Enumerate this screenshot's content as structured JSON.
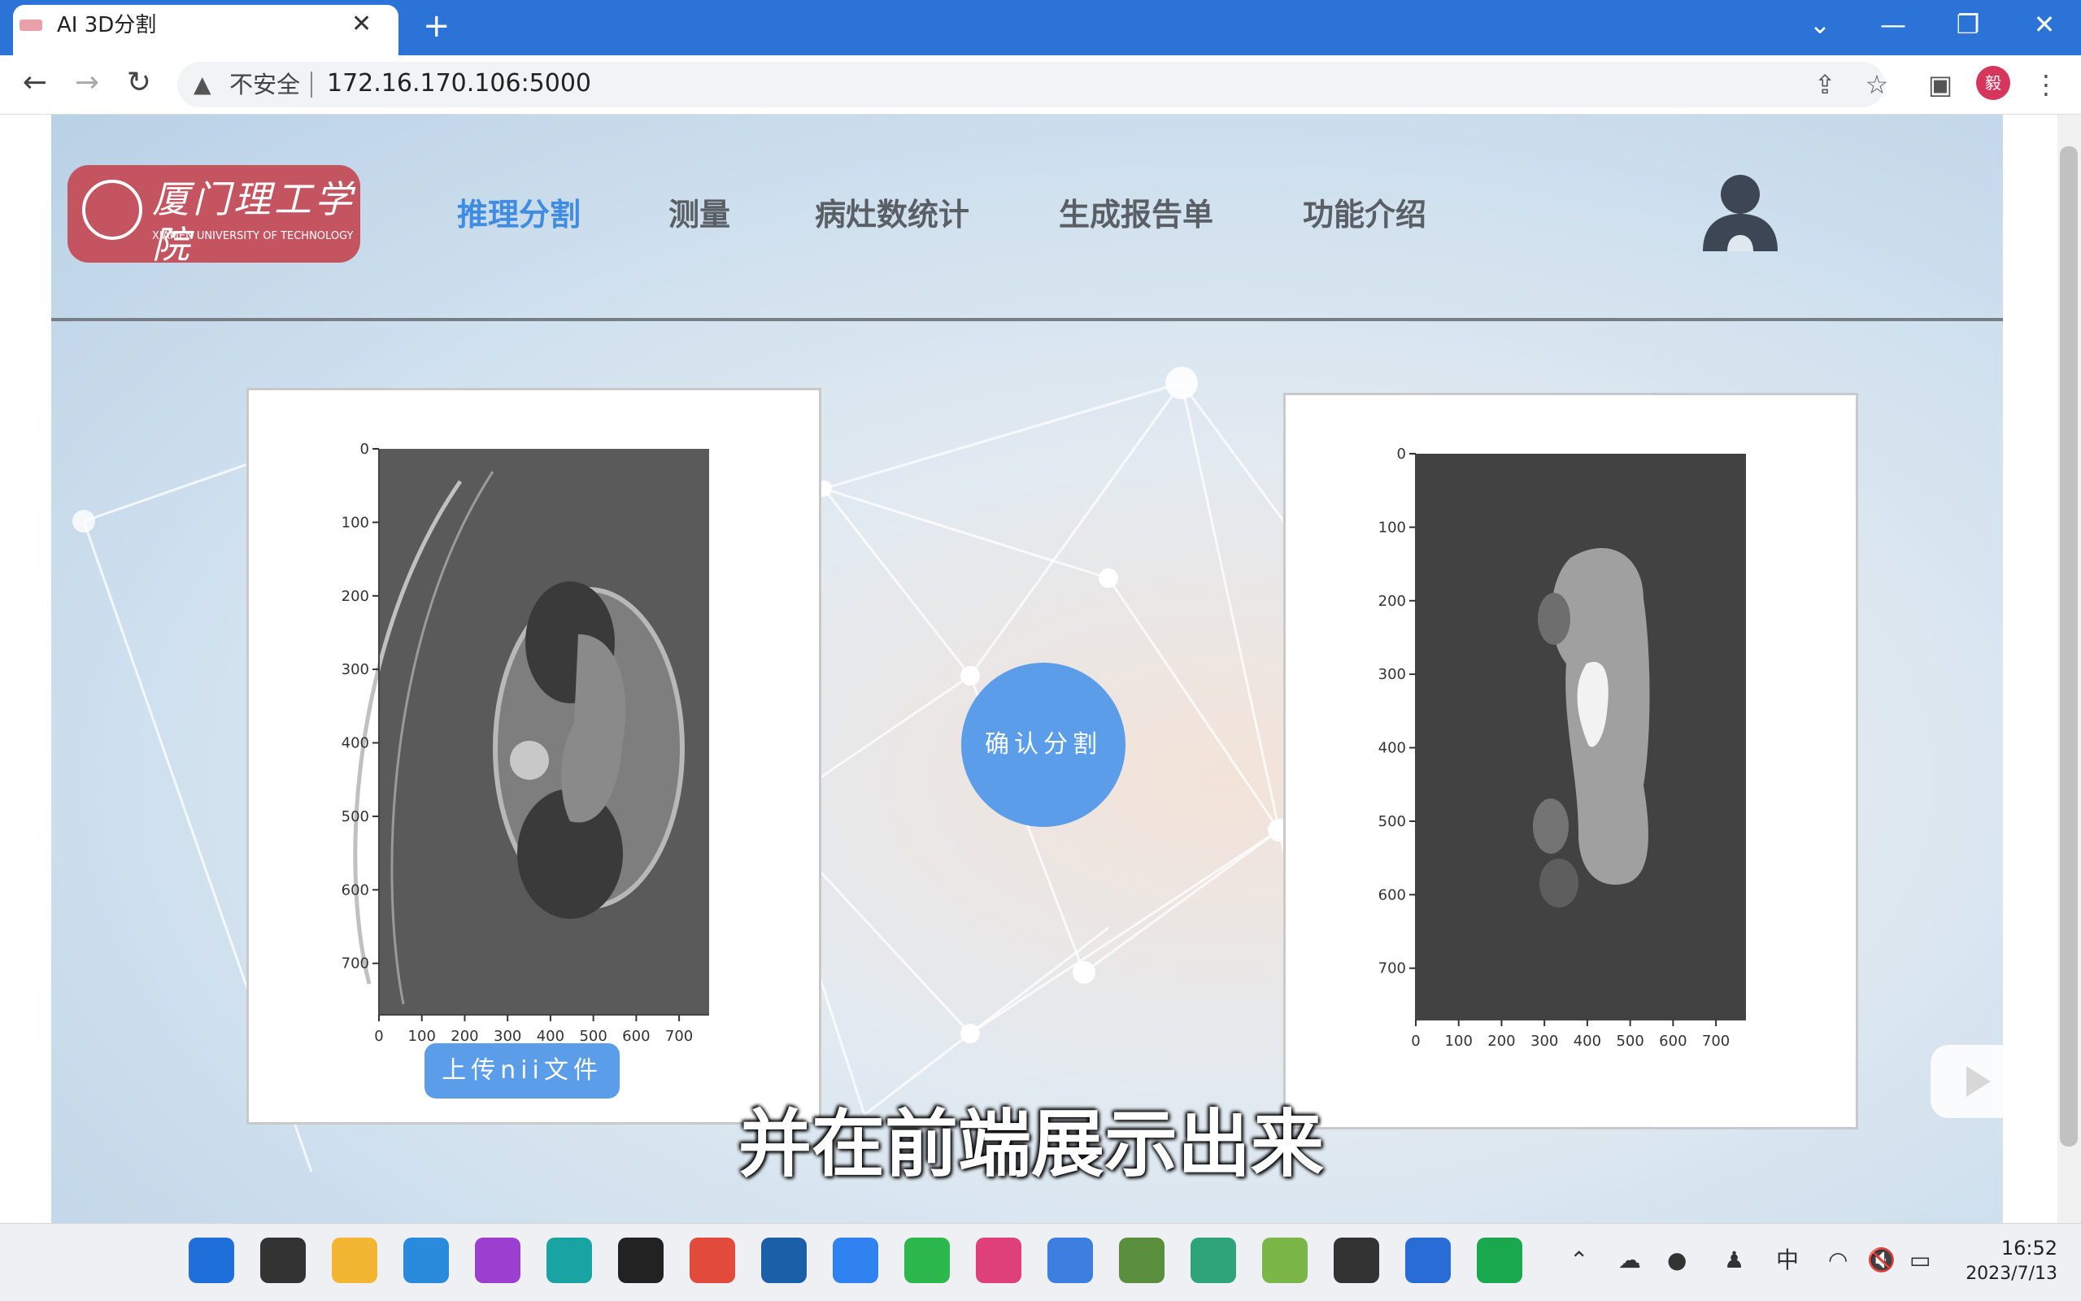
{
  "browser": {
    "tab_title": "AI 3D分割",
    "security_label": "不安全",
    "url": "172.16.170.106:5000",
    "profile_initial": "毅",
    "new_tab_symbol": "+",
    "close_symbol": "✕"
  },
  "site": {
    "logo_text": "厦门理工学院",
    "logo_subtitle": "XIAMEN UNIVERSITY OF TECHNOLOGY",
    "nav": [
      "推理分割",
      "测量",
      "病灶数统计",
      "生成报告单",
      "功能介绍"
    ],
    "active_nav": "推理分割",
    "accent_color": "#3f8ce0",
    "button_color": "#5b9de9"
  },
  "main": {
    "confirm_button": "确认分割",
    "upload_button": "上传nii文件",
    "caption": "并在前端展示出来"
  },
  "chart_data": [
    {
      "type": "heatmap",
      "content": "CT axial slice (grayscale)",
      "x_ticks": [
        0,
        100,
        200,
        300,
        400,
        500,
        600,
        700
      ],
      "y_ticks": [
        0,
        100,
        200,
        300,
        400,
        500,
        600,
        700
      ],
      "xlim": [
        0,
        770
      ],
      "ylim": [
        770,
        0
      ]
    },
    {
      "type": "heatmap",
      "content": "Segmentation mask (grayscale labels)",
      "x_ticks": [
        0,
        100,
        200,
        300,
        400,
        500,
        600,
        700
      ],
      "y_ticks": [
        0,
        100,
        200,
        300,
        400,
        500,
        600,
        700
      ],
      "xlim": [
        0,
        770
      ],
      "ylim": [
        770,
        0
      ]
    }
  ],
  "taskbar": {
    "apps": [
      "start",
      "search",
      "file-explorer",
      "vscode",
      "hex-editor",
      "edge",
      "qq",
      "chrome",
      "app-circle",
      "feishu",
      "wechat",
      "app-pink",
      "baidu-netdisk",
      "photos",
      "app-green",
      "notepad",
      "terminal",
      "app-blue",
      "pycharm"
    ],
    "tray_language": "中",
    "time": "16:52",
    "date": "2023/7/13"
  }
}
